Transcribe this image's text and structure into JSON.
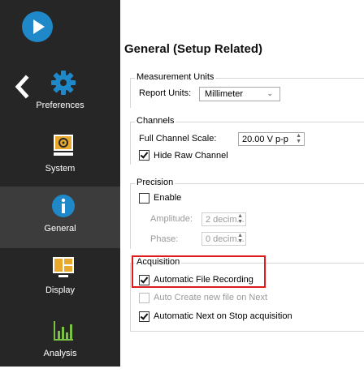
{
  "sidebar": {
    "items": [
      {
        "label": "Preferences",
        "icon": "gear-icon"
      },
      {
        "label": "System",
        "icon": "system-monitor-icon"
      },
      {
        "label": "General",
        "icon": "info-icon"
      },
      {
        "label": "Display",
        "icon": "display-layout-icon"
      },
      {
        "label": "Analysis",
        "icon": "bar-chart-icon"
      }
    ],
    "active": "General"
  },
  "page": {
    "title": "General (Setup Related)"
  },
  "measurement_units": {
    "title": "Measurement Units",
    "report_units_label": "Report Units:",
    "report_units_value": "Millimeter"
  },
  "channels": {
    "title": "Channels",
    "full_scale_label": "Full Channel Scale:",
    "full_scale_value": "20.00 V p-p",
    "hide_raw_label": "Hide Raw Channel",
    "hide_raw_checked": true
  },
  "precision": {
    "title": "Precision",
    "enable_label": "Enable",
    "enable_checked": false,
    "amplitude_label": "Amplitude:",
    "amplitude_value": "2 decim...",
    "phase_label": "Phase:",
    "phase_value": "0 decim..."
  },
  "acquisition": {
    "title": "Acquisition",
    "auto_file_label": "Automatic File Recording",
    "auto_file_checked": true,
    "auto_create_label": "Auto Create new file on Next",
    "auto_create_checked": false,
    "auto_next_label": "Automatic Next on Stop acquisition",
    "auto_next_checked": true
  },
  "colors": {
    "sidebar_bg": "#262626",
    "active_item_bg": "#3c3c3c",
    "accent_blue": "#1e88c9",
    "highlight_red": "#e0191c"
  }
}
